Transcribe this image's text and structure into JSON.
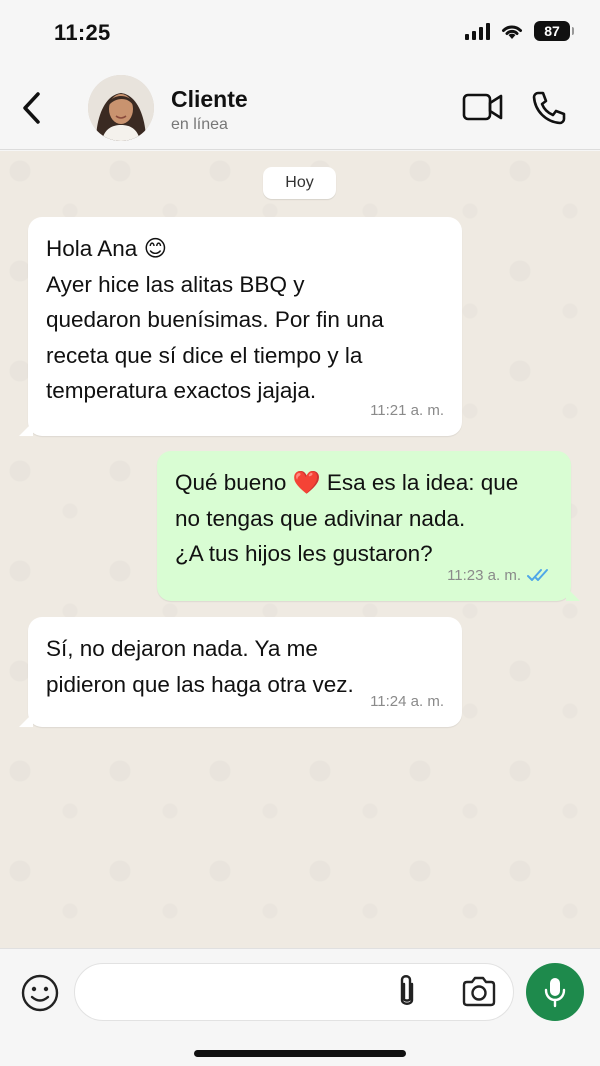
{
  "status_bar": {
    "time": "11:25",
    "battery": "87"
  },
  "header": {
    "contact_name": "Cliente",
    "contact_status": "en línea"
  },
  "chat": {
    "date_chip": "Hoy",
    "messages": [
      {
        "direction": "incoming",
        "text": "Hola Ana 😊\nAyer hice las alitas BBQ y\nquedaron buenísimas. Por fin una\nreceta que sí dice el tiempo y la\ntemperatura exactos jajaja.",
        "time": "11:21 a. m."
      },
      {
        "direction": "outgoing",
        "text": "Qué bueno ❤️ Esa es la idea: que\nno tengas que adivinar nada.\n¿A tus hijos les gustaron?",
        "time": "11:23 a. m.",
        "status": "read"
      },
      {
        "direction": "incoming",
        "text": "Sí, no dejaron nada. Ya me\npidieron que las haga otra vez.",
        "time": "11:24 a. m."
      }
    ]
  },
  "input_bar": {
    "placeholder": ""
  },
  "colors": {
    "accent_green": "#1e8a4c",
    "outgoing_bubble": "#d9fdd3",
    "read_ticks": "#4fa7e8",
    "chat_background": "#efeae2"
  }
}
